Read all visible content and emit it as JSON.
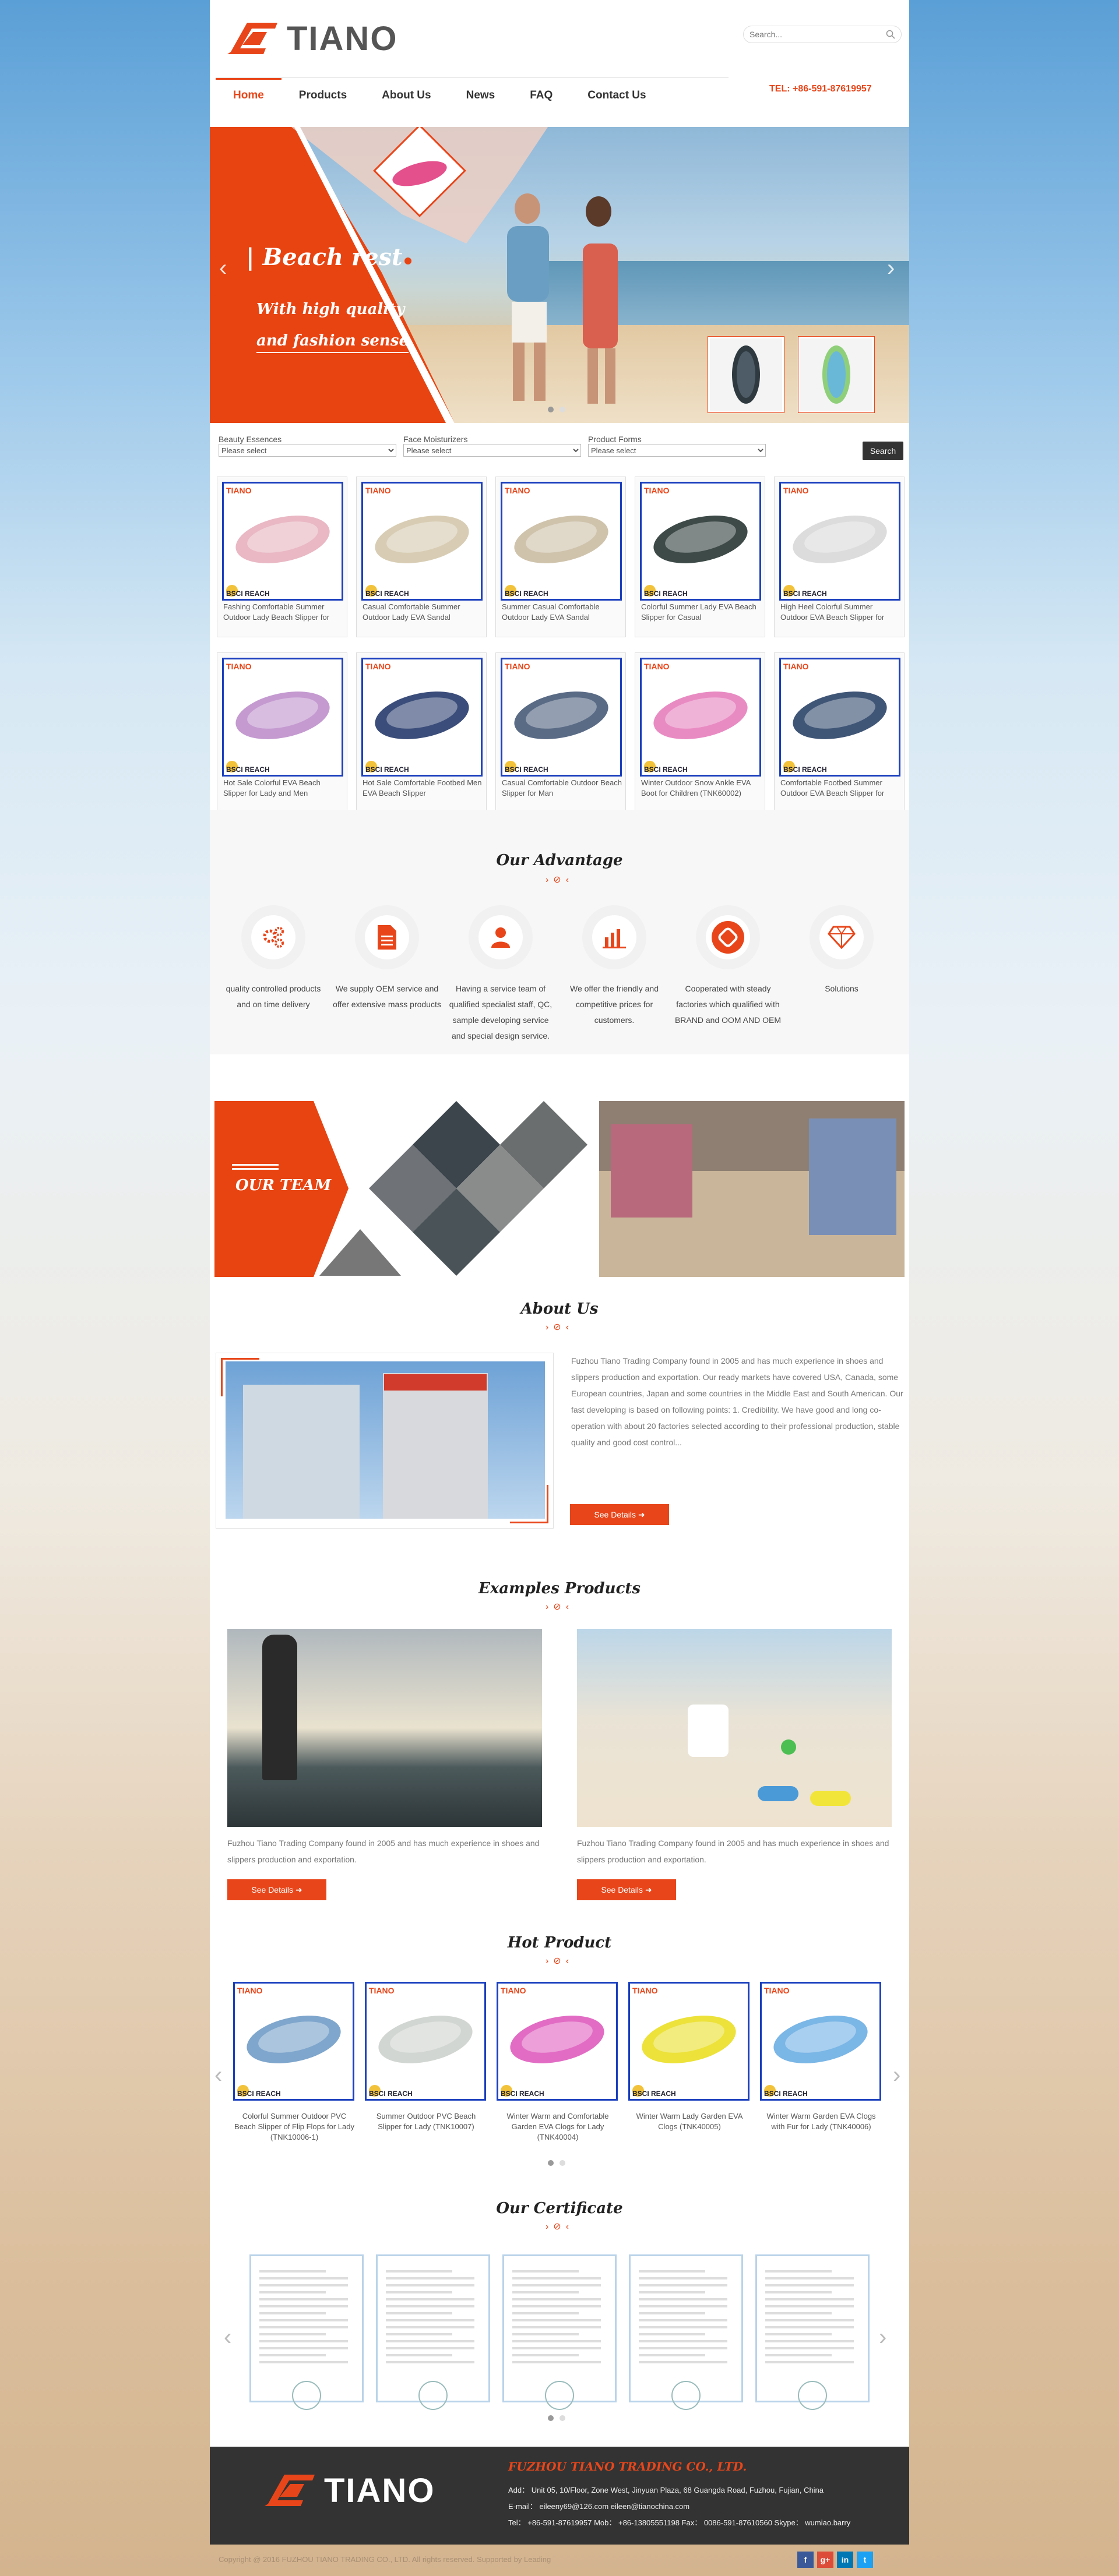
{
  "header": {
    "logo_text": "TIANO",
    "search_placeholder": "Search...",
    "tel": "TEL: +86-591-87619957"
  },
  "nav": [
    {
      "label": "Home"
    },
    {
      "label": "Products"
    },
    {
      "label": "About Us"
    },
    {
      "label": "News"
    },
    {
      "label": "FAQ"
    },
    {
      "label": "Contact Us"
    }
  ],
  "banner": {
    "title": "| Beach rest",
    "line1": "With high quality",
    "line2": "and fashion sense"
  },
  "filters": [
    {
      "label": "Beauty Essences",
      "value": "Please select"
    },
    {
      "label": "Face Moisturizers",
      "value": "Please select"
    },
    {
      "label": "Product Forms",
      "value": "Please select"
    }
  ],
  "search_button": "Search",
  "card_brand": "TIANO",
  "card_certs": "BSCI  REACH",
  "products": [
    {
      "caption": "Fashing Comfortable Summer Outdoor Lady Beach Slipper for",
      "color": "#e9b8c4"
    },
    {
      "caption": "Casual Comfortable Summer Outdoor Lady EVA Sandal",
      "color": "#d8cdb4"
    },
    {
      "caption": "Summer Casual Comfortable Outdoor Lady EVA Sandal",
      "color": "#cfc3ac"
    },
    {
      "caption": "Colorful Summer Lady EVA Beach Slipper for Casual",
      "color": "#3d4a48"
    },
    {
      "caption": "High Heel Colorful Summer Outdoor EVA Beach Slipper for",
      "color": "#dcdcdc"
    },
    {
      "caption": "Hot Sale Colorful EVA Beach Slipper for Lady and Men",
      "color": "#c49ad0"
    },
    {
      "caption": "Hot Sale Comfortable Footbed Men EVA Beach Slipper",
      "color": "#3b4d7a"
    },
    {
      "caption": "Casual Comfortable Outdoor Beach Slipper for Man",
      "color": "#5a6b86"
    },
    {
      "caption": "Winter Outdoor Snow Ankle EVA Boot for Children (TNK60002)",
      "color": "#e98bc3"
    },
    {
      "caption": "Comfortable Footbed Summer Outdoor EVA Beach Slipper for",
      "color": "#405677"
    }
  ],
  "advantage": {
    "title": "Our Advantage",
    "items": [
      {
        "icon": "gears-icon",
        "text": "quality controlled products and on time delivery"
      },
      {
        "icon": "document-icon",
        "text": "We supply OEM service and offer extensive mass products"
      },
      {
        "icon": "person-icon",
        "text": "Having a service team of qualified specialist staff, QC, sample developing service and special design service."
      },
      {
        "icon": "bar-chart-icon",
        "text": "We offer the friendly and competitive prices for customers."
      },
      {
        "icon": "handshake-icon",
        "text": "Cooperated with steady factories which qualified with BRAND and OOM AND OEM"
      },
      {
        "icon": "diamond-icon",
        "text": "Solutions"
      }
    ]
  },
  "team": {
    "title": "OUR TEAM"
  },
  "about": {
    "title": "About Us",
    "text": "Fuzhou Tiano Trading Company found in 2005 and has much experience in shoes and slippers production and exportation. Our ready markets have covered USA, Canada, some European countries, Japan and some countries in the Middle East and South American. Our fast developing is based on following points: 1. Credibility. We have good and long co-operation with about 20 factories selected according to their professional production, stable quality and good cost control...",
    "button": "See Details"
  },
  "examples": {
    "title": "Examples Products",
    "items": [
      {
        "text": "Fuzhou Tiano Trading Company found in 2005 and has much experience in shoes and slippers production and exportation.",
        "button": "See Details"
      },
      {
        "text": "Fuzhou Tiano Trading Company found in 2005 and has much experience in shoes and slippers production and exportation.",
        "button": "See Details"
      }
    ]
  },
  "hot": {
    "title": "Hot Product",
    "items": [
      {
        "caption": "Colorful Summer Outdoor PVC Beach Slipper of Flip Flops for Lady (TNK10006-1)",
        "color": "#7fa6cc"
      },
      {
        "caption": "Summer Outdoor PVC Beach Slipper for Lady (TNK10007)",
        "color": "#d2d6d2"
      },
      {
        "caption": "Winter Warm and Comfortable Garden EVA Clogs for Lady (TNK40004)",
        "color": "#e26cc4"
      },
      {
        "caption": "Winter Warm Lady Garden EVA Clogs (TNK40005)",
        "color": "#ece23a"
      },
      {
        "caption": "Winter Warm Garden EVA Clogs with Fur for Lady (TNK40006)",
        "color": "#7ab6e6"
      }
    ]
  },
  "certificate": {
    "title": "Our Certificate",
    "count": 5
  },
  "footer": {
    "logo_text": "TIANO",
    "company": "FUZHOU TIANO TRADING CO., LTD.",
    "address": "Add： Unit 05, 10/Floor, Zone West, Jinyuan Plaza, 68 Guangda Road, Fuzhou, Fujian, China",
    "email": "E-mail： eileeny69@126.com    eileen@tianochina.com",
    "tel": "Tel： +86-591-87619957   Mob： +86-13805551198    Fax： 0086-591-87610560   Skype： wumiao.barry",
    "copyright": "Copyright @ 2016 FUZHOU TIANO TRADING CO., LTD.   All rights reserved. Supported by Leading"
  },
  "social": [
    {
      "icon": "facebook-icon",
      "glyph": "f",
      "color": "#3b5998"
    },
    {
      "icon": "google-plus-icon",
      "glyph": "g+",
      "color": "#dd4b39"
    },
    {
      "icon": "linkedin-icon",
      "glyph": "in",
      "color": "#0077b5"
    },
    {
      "icon": "twitter-icon",
      "glyph": "t",
      "color": "#1da1f2"
    }
  ],
  "colors": {
    "accent": "#e8461a",
    "dark": "#333333",
    "card_border": "#1b3fbe"
  }
}
